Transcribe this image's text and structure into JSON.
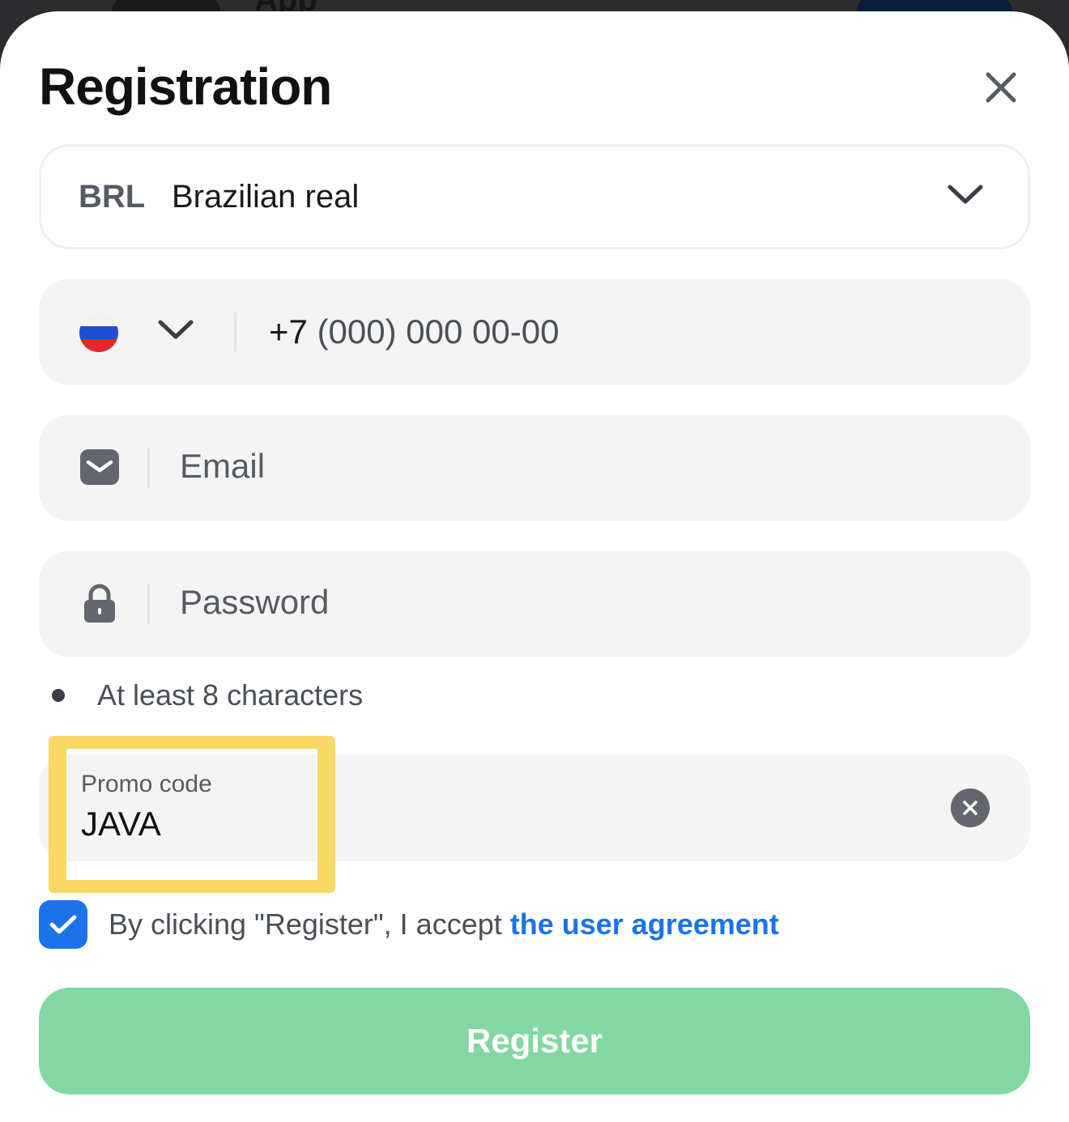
{
  "background_app": {
    "title": "App"
  },
  "modal": {
    "title": "Registration",
    "close_icon": "close-icon"
  },
  "currency": {
    "code": "BRL",
    "name": "Brazilian real"
  },
  "phone": {
    "country_flag": "russia-flag",
    "prefix": "+7",
    "placeholder_rest": "(000) 000 00-00"
  },
  "email": {
    "placeholder": "Email",
    "icon": "mail-icon"
  },
  "password": {
    "placeholder": "Password",
    "icon": "lock-icon",
    "hint": "At least 8 characters"
  },
  "promo": {
    "label": "Promo code",
    "value": "JAVA"
  },
  "agreement": {
    "checked": true,
    "text": "By clicking \"Register\", I accept",
    "link": "the user agreement"
  },
  "register_label": "Register",
  "colors": {
    "accent": "#1a73e8",
    "register_bg": "#82d7a2",
    "highlight": "#f9d558",
    "field_bg": "#f4f4f5"
  }
}
